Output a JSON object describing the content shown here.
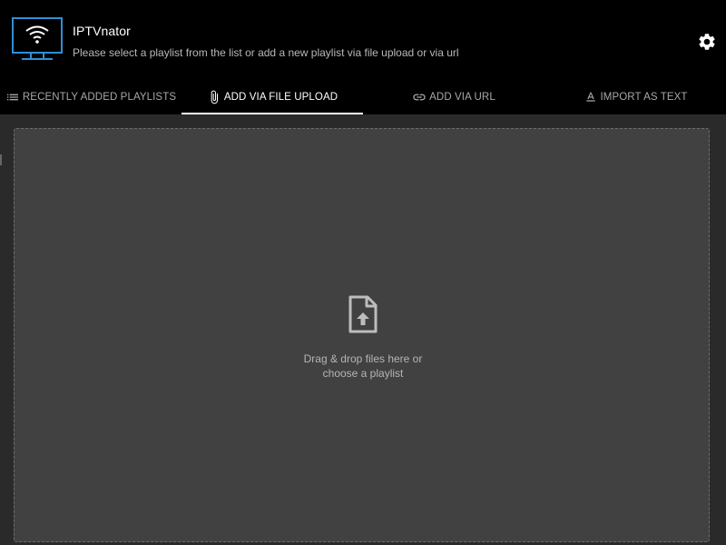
{
  "app": {
    "title": "IPTVnator",
    "subtitle": "Please select a playlist from the list or add a new playlist via file upload or via url"
  },
  "header": {
    "settings_icon": "gear-icon",
    "logo_icon": "tv-wifi-icon"
  },
  "tabs": [
    {
      "label": "RECENTLY ADDED PLAYLISTS",
      "icon": "list-icon",
      "active": false
    },
    {
      "label": "ADD VIA FILE UPLOAD",
      "icon": "paperclip-icon",
      "active": true
    },
    {
      "label": "ADD VIA URL",
      "icon": "link-icon",
      "active": false
    },
    {
      "label": "IMPORT AS TEXT",
      "icon": "text-format-icon",
      "active": false
    }
  ],
  "dropzone": {
    "icon": "file-upload-icon",
    "line1": "Drag & drop files here or",
    "line2": "choose a playlist"
  },
  "colors": {
    "header_bg": "#000000",
    "dropzone_bg": "#414141",
    "logo_blue": "#2f8fd6",
    "active_tab": "#ffffff",
    "inactive_tab": "#a8a8a8"
  }
}
